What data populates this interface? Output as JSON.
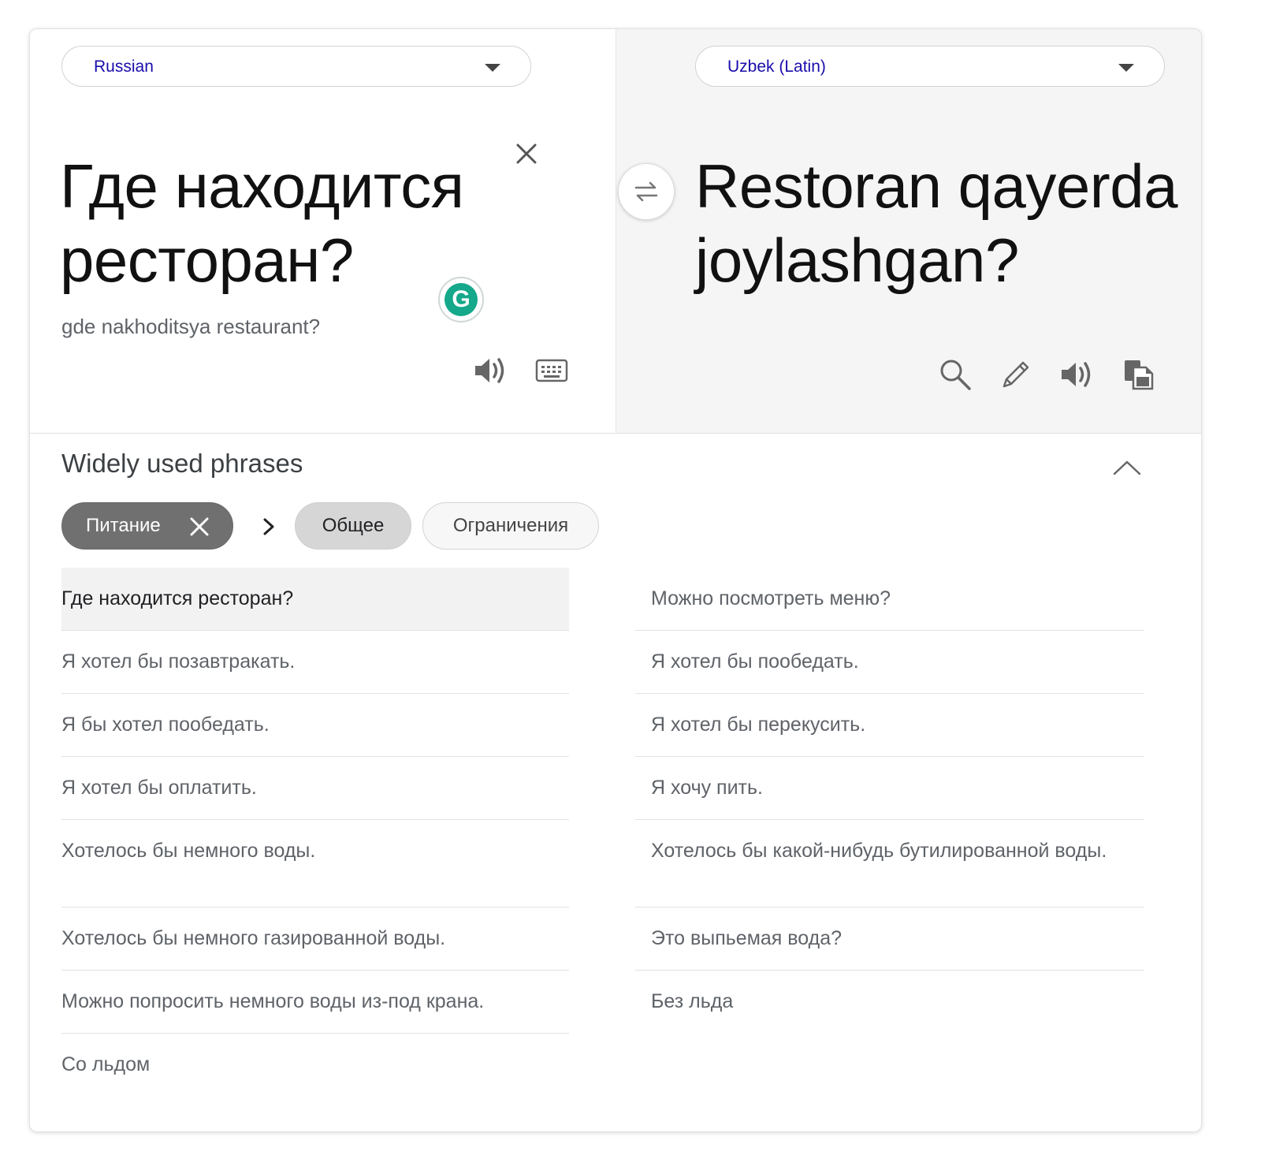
{
  "source": {
    "language": "Russian",
    "text": "Где находится ресторан?",
    "transliteration": "gde nakhoditsya restaurant?"
  },
  "target": {
    "language": "Uzbek (Latin)",
    "text": "Restoran qayerda joylashgan?"
  },
  "grammarly": {
    "letter": "G"
  },
  "phrases": {
    "title": "Widely used phrases",
    "chips": {
      "active": "Питание",
      "general": "Общее",
      "restrictions": "Ограничения"
    },
    "left": [
      "Где находится ресторан?",
      "Я хотел бы позавтракать.",
      "Я бы хотел пообедать.",
      "Я хотел бы оплатить.",
      "Хотелось бы немного воды.",
      "Хотелось бы немного газированной воды.",
      "Можно попросить немного воды из-под крана.",
      "Со льдом"
    ],
    "right": [
      "Можно посмотреть меню?",
      "Я хотел бы пообедать.",
      "Я хотел бы перекусить.",
      "Я хочу пить.",
      "Хотелось бы какой-нибудь бутилированной воды.",
      "Это выпьемая вода?",
      "Без льда"
    ]
  },
  "icons": {
    "clear": "close-icon",
    "swap": "swap-arrows-icon",
    "speaker": "speaker-icon",
    "keyboard": "keyboard-icon",
    "search": "search-icon",
    "edit": "pencil-icon",
    "copy": "copy-icon",
    "collapse": "chevron-up-icon"
  }
}
